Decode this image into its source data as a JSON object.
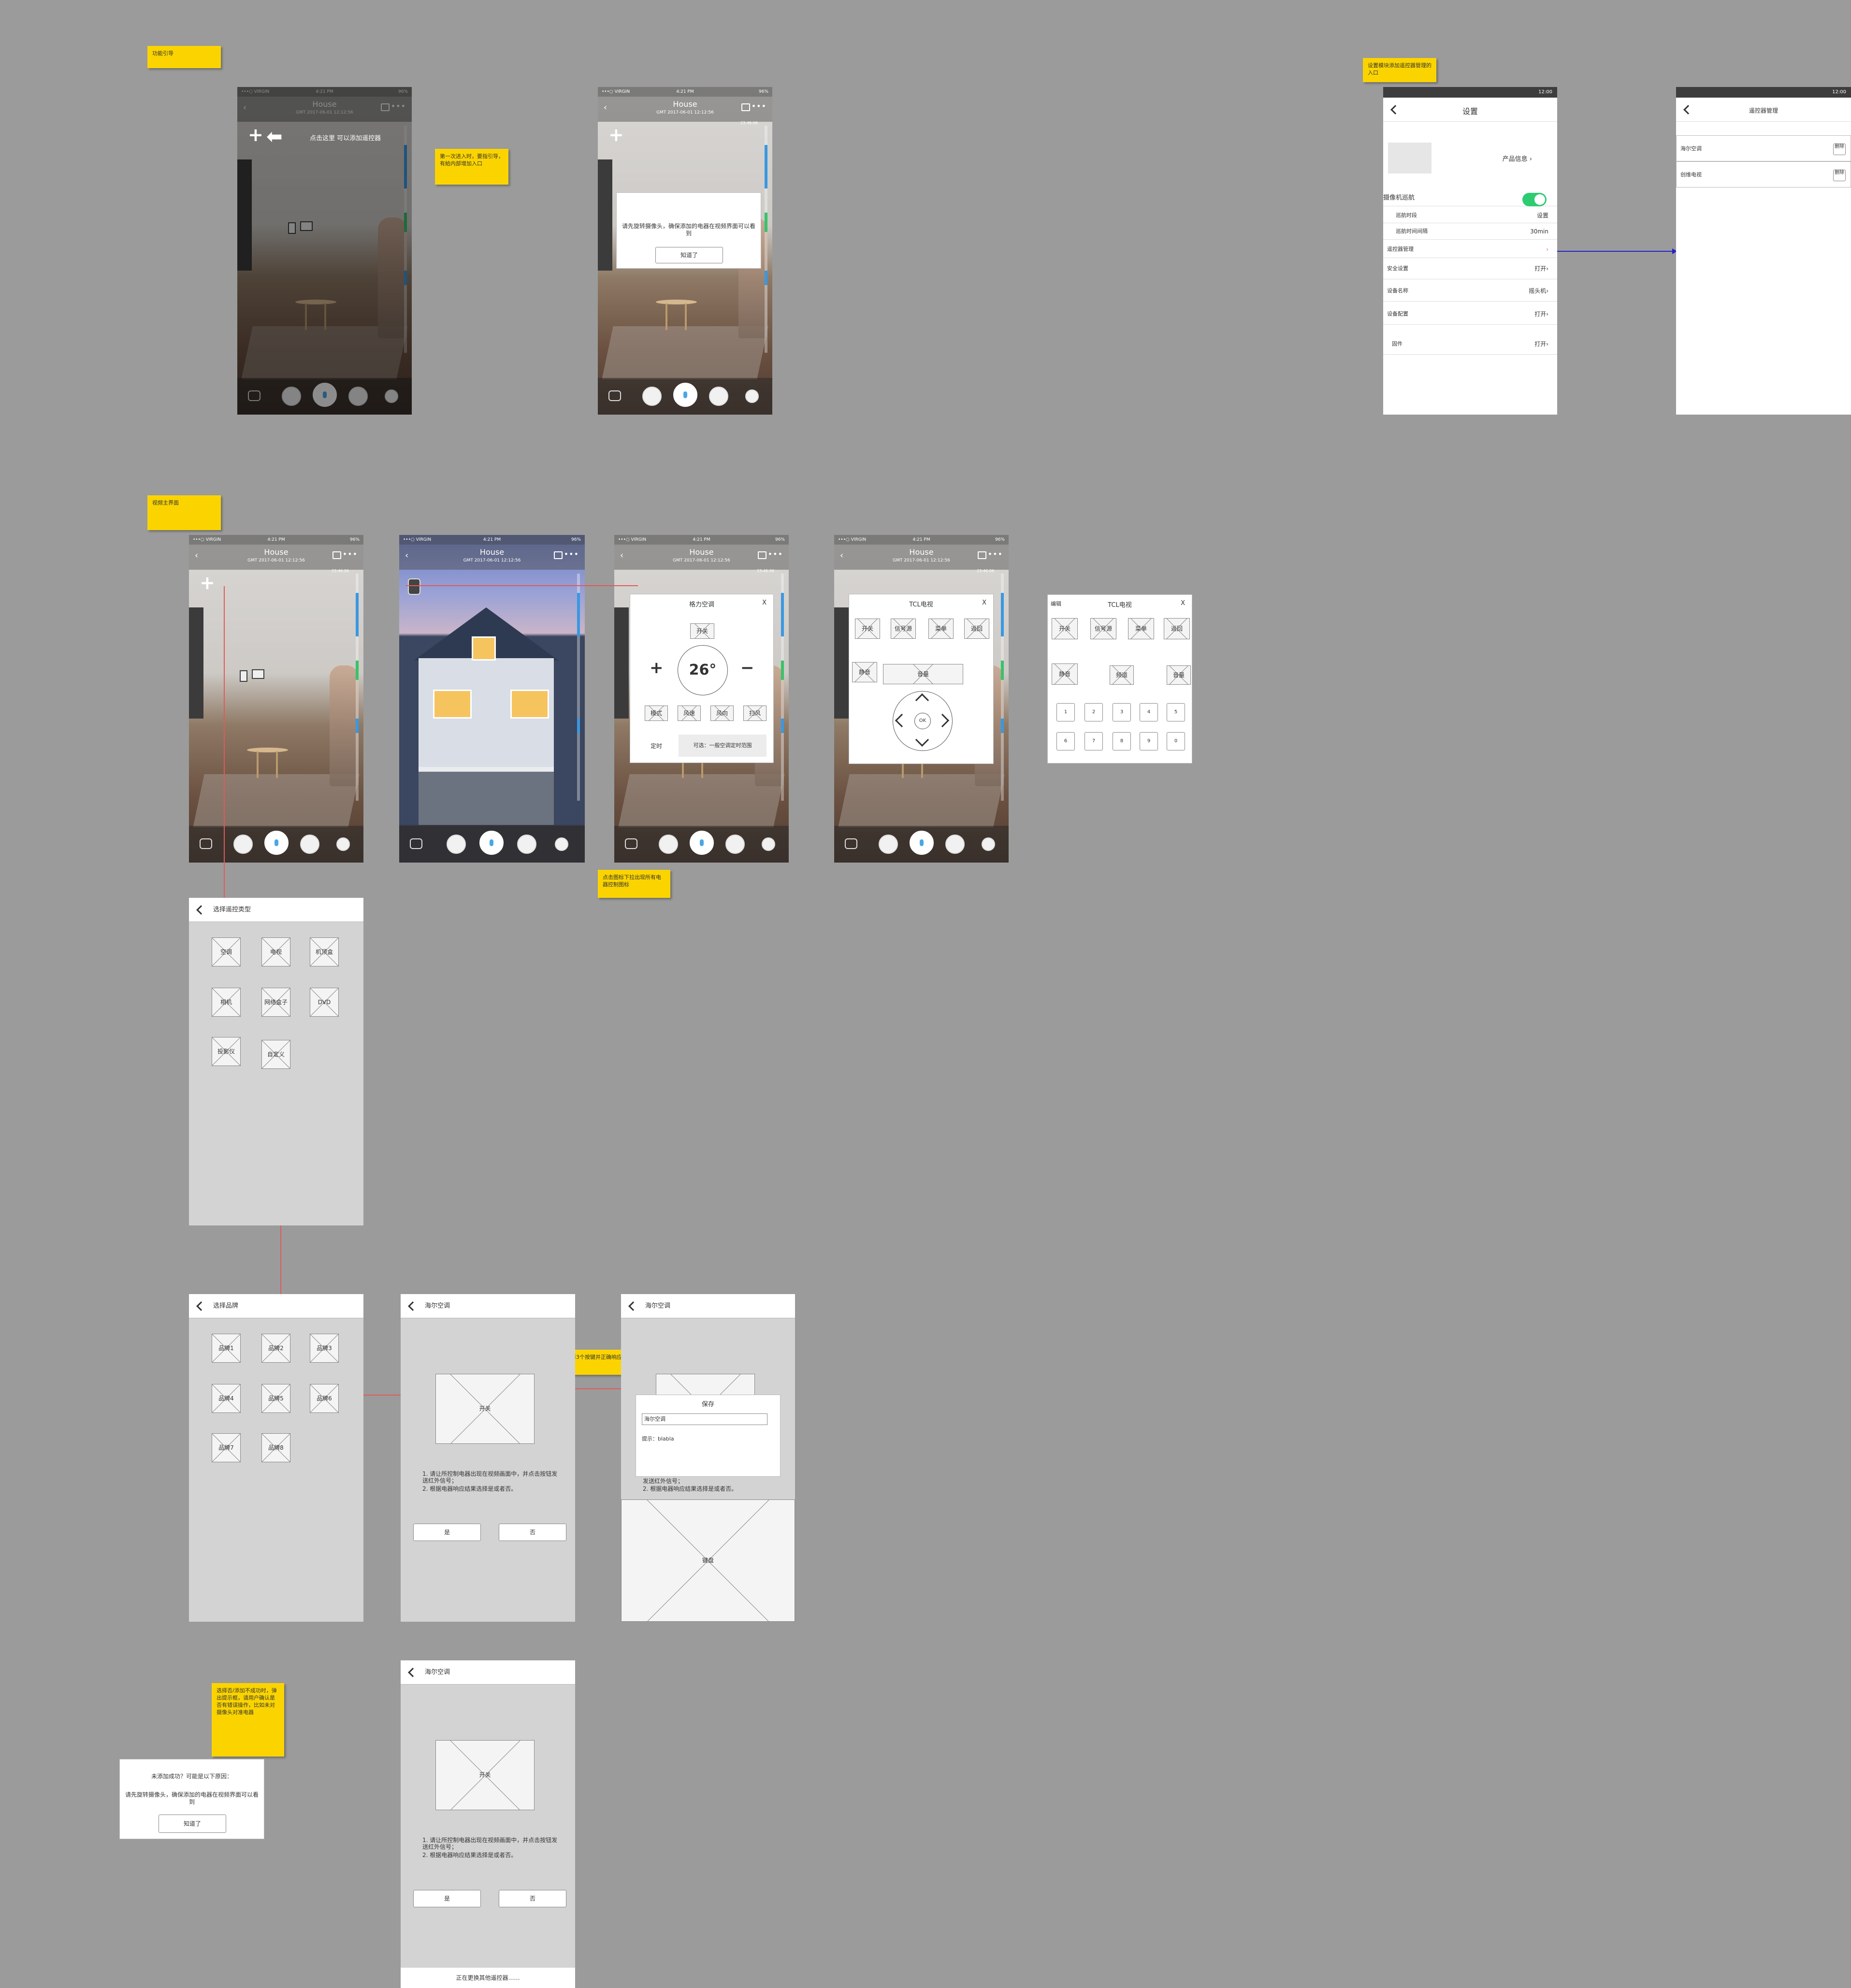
{
  "stickies": {
    "guide": "功能引导",
    "first_use": "第一次进入时，要指引导，有給内部增加入口",
    "settings_entry": "设置模块添加遥控器管理的入口",
    "main_ui": "视频主界面",
    "tap_icon": "点击图标下拉出现所有电器控制图标",
    "pick3": "选择3个按键并正确响应",
    "fail_note": "选择否/添加不成功时，弹出提示框，请用户确认是否有错误操作，比如未对摄像头对准电器"
  },
  "phone_common": {
    "carrier": "•••○ VIRGIN",
    "time": "4:21 PM",
    "battery": "96%",
    "title": "House",
    "subtitle": "GMT 2017-06-01 12:12:56",
    "time_mark": "23:46:06",
    "back": "‹",
    "more": "•••"
  },
  "guide_phone": {
    "hint": "点击这里 可以添加遥控器"
  },
  "notice_phone": {
    "message": "请先旋转摄像头，确保添加的电器在视频界面可以看到",
    "ok": "知道了"
  },
  "settings": {
    "status_time": "12:00",
    "title": "设置",
    "product_info": "产品信息 ›",
    "cruise": "摄像机巡航",
    "cruise_time": "巡航时段",
    "cruise_time_value": "设置",
    "cruise_interval": "巡航时间间隔",
    "cruise_interval_value": "30min",
    "remote_mgmt": "遥控器管理",
    "remote_mgmt_value": "›",
    "security": "安全设置",
    "security_value": "打开›",
    "device_name": "设备名称",
    "device_name_value": "摇头机›",
    "device_config": "设备配置",
    "device_config_value": "打开›",
    "firmware": "固件",
    "firmware_value": "打开›"
  },
  "remote_mgmt": {
    "status_time": "12:00",
    "title": "遥控器管理",
    "items": [
      {
        "name": "海尔空调",
        "del": "删除"
      },
      {
        "name": "创维电视",
        "del": "删除"
      }
    ]
  },
  "ac_panel": {
    "title": "格力空调",
    "close": "X",
    "power": "开关",
    "temp": "26°",
    "plus": "+",
    "minus": "−",
    "buttons": [
      "模式",
      "风速",
      "风向",
      "扫风"
    ],
    "timer": "定时",
    "timer_hint": "可选：一般空调定时范围"
  },
  "tv_panel": {
    "title": "TCL电视",
    "close": "X",
    "row1": [
      "开关",
      "信号源",
      "菜单",
      "返回"
    ],
    "mute": "静音",
    "volume": "音量",
    "ok": "OK"
  },
  "tv_panel2": {
    "edit": "编辑",
    "title": "TCL电视",
    "close": "X",
    "row1": [
      "开关",
      "信号源",
      "菜单",
      "返回"
    ],
    "mute": "静音",
    "channel": "频道",
    "volume": "音量",
    "numbers": [
      "1",
      "2",
      "3",
      "4",
      "5",
      "6",
      "7",
      "8",
      "9",
      "0"
    ]
  },
  "remote_type": {
    "title": "选择遥控类型",
    "items": [
      "空调",
      "电视",
      "机顶盒",
      "相机",
      "网络盒子",
      "DVD",
      "投影仪",
      "自定义"
    ]
  },
  "brand": {
    "title": "选择品牌",
    "items": [
      "品牌1",
      "品牌2",
      "品牌3",
      "品牌4",
      "品牌5",
      "品牌6",
      "品牌7",
      "品牌8"
    ]
  },
  "test1": {
    "title": "海尔空调",
    "button": "开关",
    "line1": "1. 请让所控制电器出现在视频画面中，并点击按钮发送红外信号；",
    "line2": "2. 根据电器响应结果选择是或者否。",
    "yes": "是",
    "no": "否"
  },
  "save": {
    "title": "海尔空调",
    "popup_title": "保存",
    "name_value": "海尔空调",
    "hint": "提示：blabla",
    "under1": "发送红外信号；",
    "under2": "2. 根据电器响应结果选择是或者否。",
    "keyboard": "键盘"
  },
  "fail": {
    "title": "未添加成功？可能是以下原因：",
    "message": "请先旋转摄像头，确保添加的电器在视频界面可以看到",
    "ok": "知道了"
  },
  "test2": {
    "title": "海尔空调",
    "button": "开关",
    "line1": "1. 请让所控制电器出现在视频画面中，并点击按钮发送红外信号；",
    "line2": "2. 根据电器响应结果选择是或者否。",
    "yes": "是",
    "no": "否",
    "footer": "正在更换其他遥控器……"
  },
  "colors": {
    "canvas": "#9b9b9b",
    "sticky": "#fbd400",
    "accent_blue": "#3a98e0",
    "toggle_green": "#2ecc71",
    "link_red": "#e05a5a"
  }
}
